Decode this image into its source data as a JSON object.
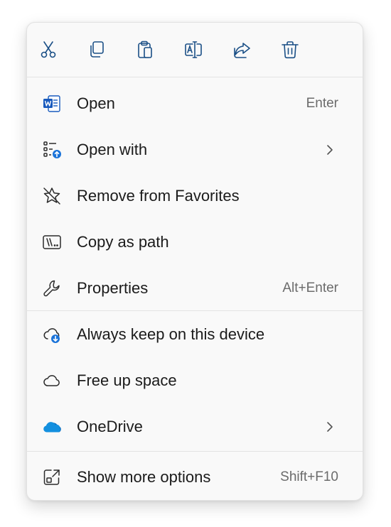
{
  "toolbar": {
    "cut_icon": "scissors-icon",
    "copy_icon": "copy-icon",
    "paste_icon": "clipboard-icon",
    "rename_icon": "rename-icon",
    "share_icon": "share-icon",
    "delete_icon": "trash-icon"
  },
  "items": [
    {
      "label": "Open",
      "shortcut": "Enter",
      "icon": "word-document-icon"
    },
    {
      "label": "Open with",
      "icon": "open-with-icon",
      "submenu": true
    },
    {
      "label": "Remove from Favorites",
      "icon": "star-remove-icon"
    },
    {
      "label": "Copy as path",
      "icon": "copy-path-icon"
    },
    {
      "label": "Properties",
      "shortcut": "Alt+Enter",
      "icon": "wrench-icon"
    },
    {
      "label": "Always keep on this device",
      "icon": "cloud-download-icon"
    },
    {
      "label": "Free up space",
      "icon": "cloud-icon"
    },
    {
      "label": "OneDrive",
      "icon": "onedrive-icon",
      "submenu": true
    },
    {
      "label": "Show more options",
      "shortcut": "Shift+F10",
      "icon": "show-more-icon"
    }
  ],
  "colors": {
    "menu_background": "#f9f9f9",
    "text": "#1b1b1b",
    "shortcut_text": "#6b6b6b",
    "icon_stroke": "#2b2b2b",
    "accent_blue": "#1a73d9",
    "word_blue": "#185abd",
    "onedrive_blue": "#0f6cbd"
  }
}
